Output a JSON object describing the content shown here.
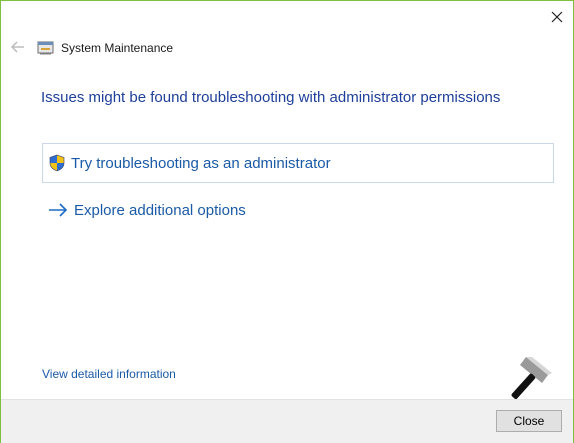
{
  "window": {
    "title": "System Maintenance",
    "close_glyph": "✕",
    "back_glyph": "←"
  },
  "main": {
    "heading": "Issues might be found troubleshooting with administrator permissions",
    "admin_option": {
      "label": "Try troubleshooting as an administrator",
      "icon": "uac-shield-icon"
    },
    "explore_option": {
      "label": "Explore additional options",
      "icon": "arrow-right-icon"
    }
  },
  "footer": {
    "details_link": "View detailed information",
    "close_button": "Close"
  },
  "colors": {
    "border": "#7fbf3f",
    "heading": "#1e3f9a",
    "link": "#1a5aa6",
    "footer_bg": "#f0f0f0"
  }
}
